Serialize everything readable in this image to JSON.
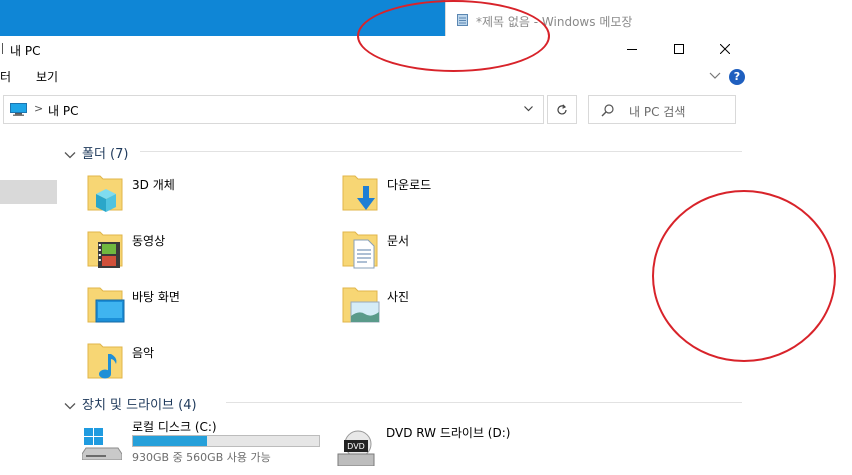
{
  "notepad": {
    "title": "*제목 없음 - Windows 메모장"
  },
  "explorer": {
    "title": "내 PC",
    "menu": [
      "터",
      "보기"
    ],
    "address": {
      "path": "내 PC"
    },
    "search": {
      "placeholder": "내 PC 검색"
    },
    "help_label": "?"
  },
  "folders": {
    "header": "폴더 (7)",
    "items": [
      {
        "label": "3D 개체",
        "icon": "3d-objects-folder-icon"
      },
      {
        "label": "다운로드",
        "icon": "downloads-folder-icon"
      },
      {
        "label": "동영상",
        "icon": "videos-folder-icon"
      },
      {
        "label": "문서",
        "icon": "documents-folder-icon"
      },
      {
        "label": "바탕 화면",
        "icon": "desktop-folder-icon"
      },
      {
        "label": "사진",
        "icon": "pictures-folder-icon"
      },
      {
        "label": "음악",
        "icon": "music-folder-icon"
      }
    ]
  },
  "devices": {
    "header": "장치 및 드라이브 (4)",
    "items": [
      {
        "label": "로컬 디스크 (C:)",
        "space": "930GB 중 560GB 사용 가능",
        "used_fraction": 0.4,
        "icon": "local-disk-icon"
      },
      {
        "label": "DVD RW 드라이브 (D:)",
        "icon": "dvd-drive-icon"
      }
    ]
  },
  "colors": {
    "titlebar_blue": "#0f86d6",
    "accent": "#26a0da",
    "annotation_red": "#d8232a",
    "section_text": "#1e395b"
  }
}
